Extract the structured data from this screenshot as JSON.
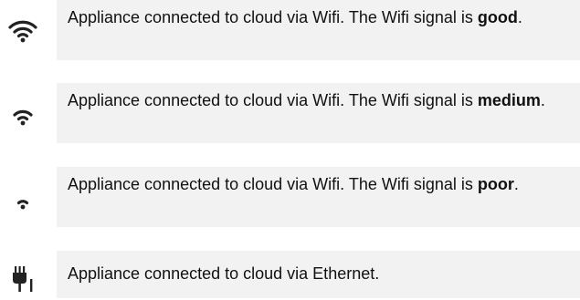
{
  "items": [
    {
      "icon": "wifi-good-icon",
      "text_before": "Appliance connected to cloud via Wifi. The Wifi signal is ",
      "strength": "good",
      "text_after": "."
    },
    {
      "icon": "wifi-medium-icon",
      "text_before": "Appliance connected to cloud via Wifi. The Wifi signal is ",
      "strength": "medium",
      "text_after": "."
    },
    {
      "icon": "wifi-poor-icon",
      "text_before": "Appliance connected to cloud via Wifi. The Wifi signal is ",
      "strength": "poor",
      "text_after": "."
    },
    {
      "icon": "ethernet-plug-icon",
      "text": "Appliance connected to cloud via Ethernet."
    }
  ],
  "colors": {
    "box_background": "#f2f2f2",
    "text": "#111111",
    "icon": "#222222"
  }
}
